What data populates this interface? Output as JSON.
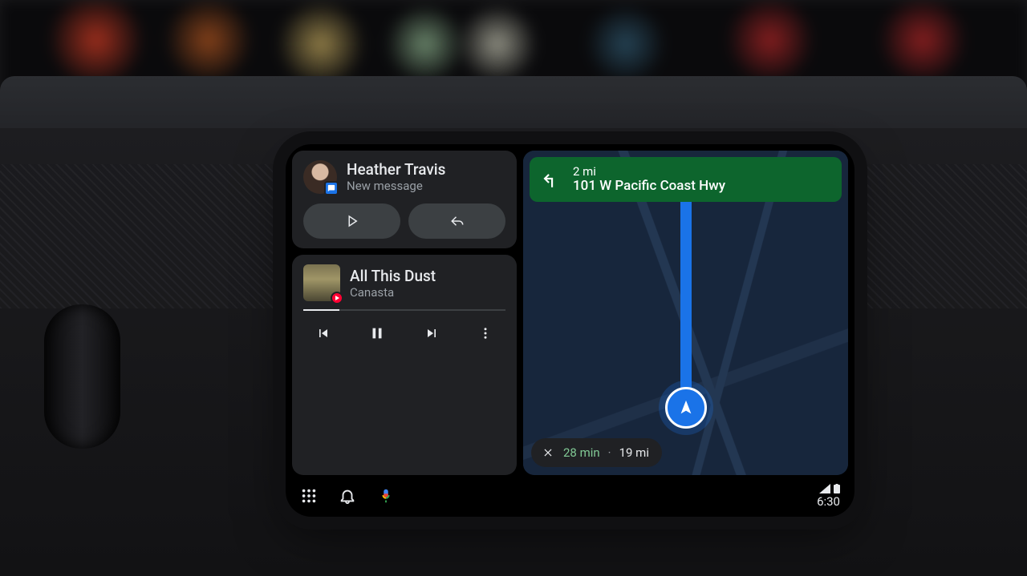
{
  "message": {
    "sender": "Heather Travis",
    "subtitle": "New message"
  },
  "media": {
    "track": "All This Dust",
    "artist": "Canasta"
  },
  "nav": {
    "distance": "2 mi",
    "road": "101 W Pacific Coast Hwy"
  },
  "eta": {
    "time": "28 min",
    "distance": "19 mi"
  },
  "statusbar": {
    "time": "6:30"
  }
}
